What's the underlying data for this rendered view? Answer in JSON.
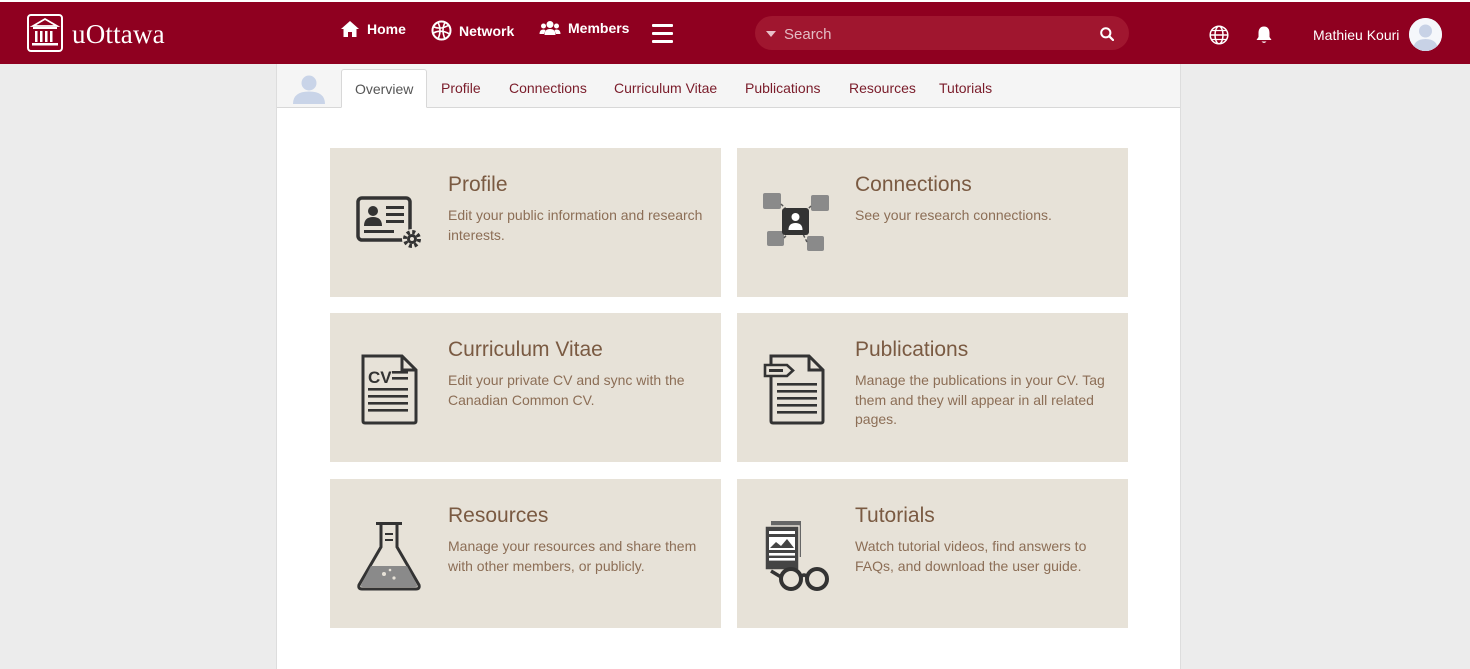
{
  "header": {
    "logo_text": "uOttawa",
    "nav": [
      {
        "label": "Home",
        "icon": "home-icon"
      },
      {
        "label": "Network",
        "icon": "network-icon"
      },
      {
        "label": "Members",
        "icon": "members-icon"
      }
    ],
    "search_placeholder": "Search",
    "user_name": "Mathieu Kouri"
  },
  "tabs": [
    "Overview",
    "Profile",
    "Connections",
    "Curriculum Vitae",
    "Publications",
    "Resources",
    "Tutorials"
  ],
  "active_tab": "Overview",
  "cards": [
    {
      "title": "Profile",
      "description": "Edit your public information and research interests.",
      "icon": "profile-card-icon"
    },
    {
      "title": "Connections",
      "description": "See your research connections.",
      "icon": "connections-icon"
    },
    {
      "title": "Curriculum Vitae",
      "description": "Edit your private CV and sync with the Canadian Common CV.",
      "icon": "cv-document-icon"
    },
    {
      "title": "Publications",
      "description": "Manage the publications in your CV. Tag them and they will appear in all related pages.",
      "icon": "publication-document-icon"
    },
    {
      "title": "Resources",
      "description": "Manage your resources and share them with other members, or publicly.",
      "icon": "flask-icon"
    },
    {
      "title": "Tutorials",
      "description": "Watch tutorial videos, find answers to FAQs, and download the user guide.",
      "icon": "glasses-documents-icon"
    }
  ],
  "colors": {
    "brand": "#8f0020",
    "card_bg": "#e7e2d8",
    "card_title": "#7a5a42",
    "tab_link": "#7a1c2a"
  }
}
